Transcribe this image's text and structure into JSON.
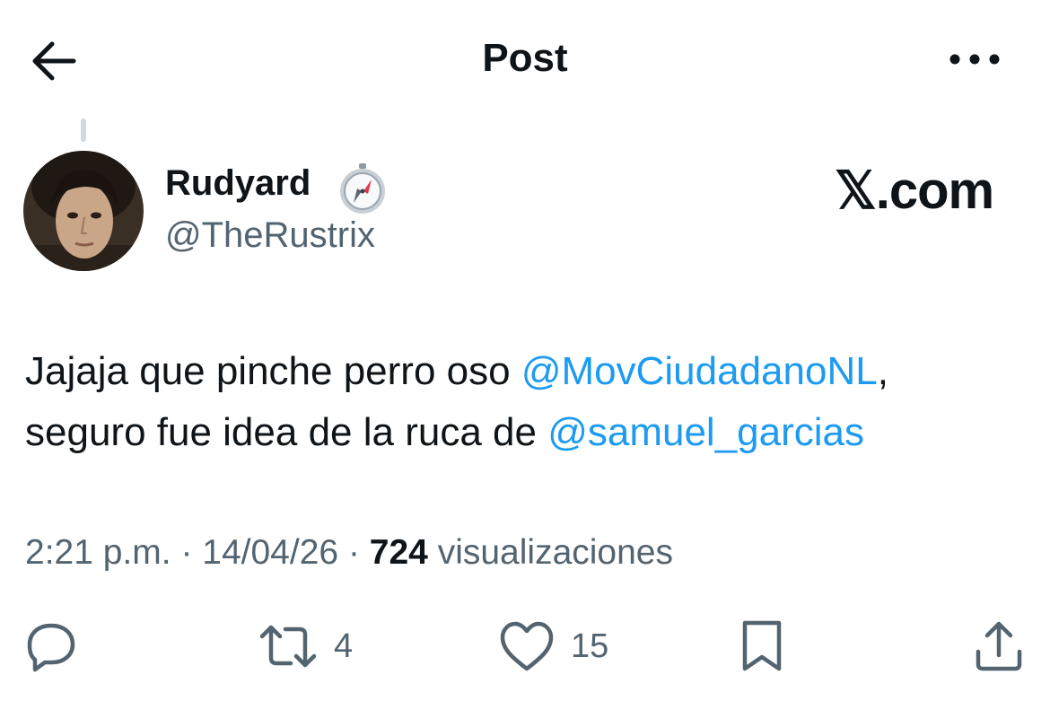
{
  "header": {
    "title": "Post",
    "back_icon": "arrow-left-icon",
    "more_icon": "more-horizontal-icon"
  },
  "author": {
    "display_name": "Rudyard",
    "badge_icon": "compass-emoji-icon",
    "handle": "@TheRustrix",
    "site_label": "𝕏.com"
  },
  "tweet": {
    "text_part1": "Jajaja que pinche perro oso ",
    "mention1": "@MovCiudadanoNL",
    "text_part2": ",",
    "text_part3": "seguro fue idea de la ruca de ",
    "mention2": "@samuel_garcias"
  },
  "meta": {
    "time": "2:21 p.m.",
    "separator": "·",
    "date": "14/04/26",
    "views_count": "724",
    "views_label": "visualizaciones"
  },
  "actions": {
    "reply_icon": "reply-icon",
    "repost_count": "4",
    "like_count": "15",
    "bookmark_icon": "bookmark-icon",
    "share_icon": "share-icon"
  },
  "colors": {
    "mention": "#1d9bf0",
    "secondary_text": "#536471",
    "primary_text": "#0f1419"
  }
}
